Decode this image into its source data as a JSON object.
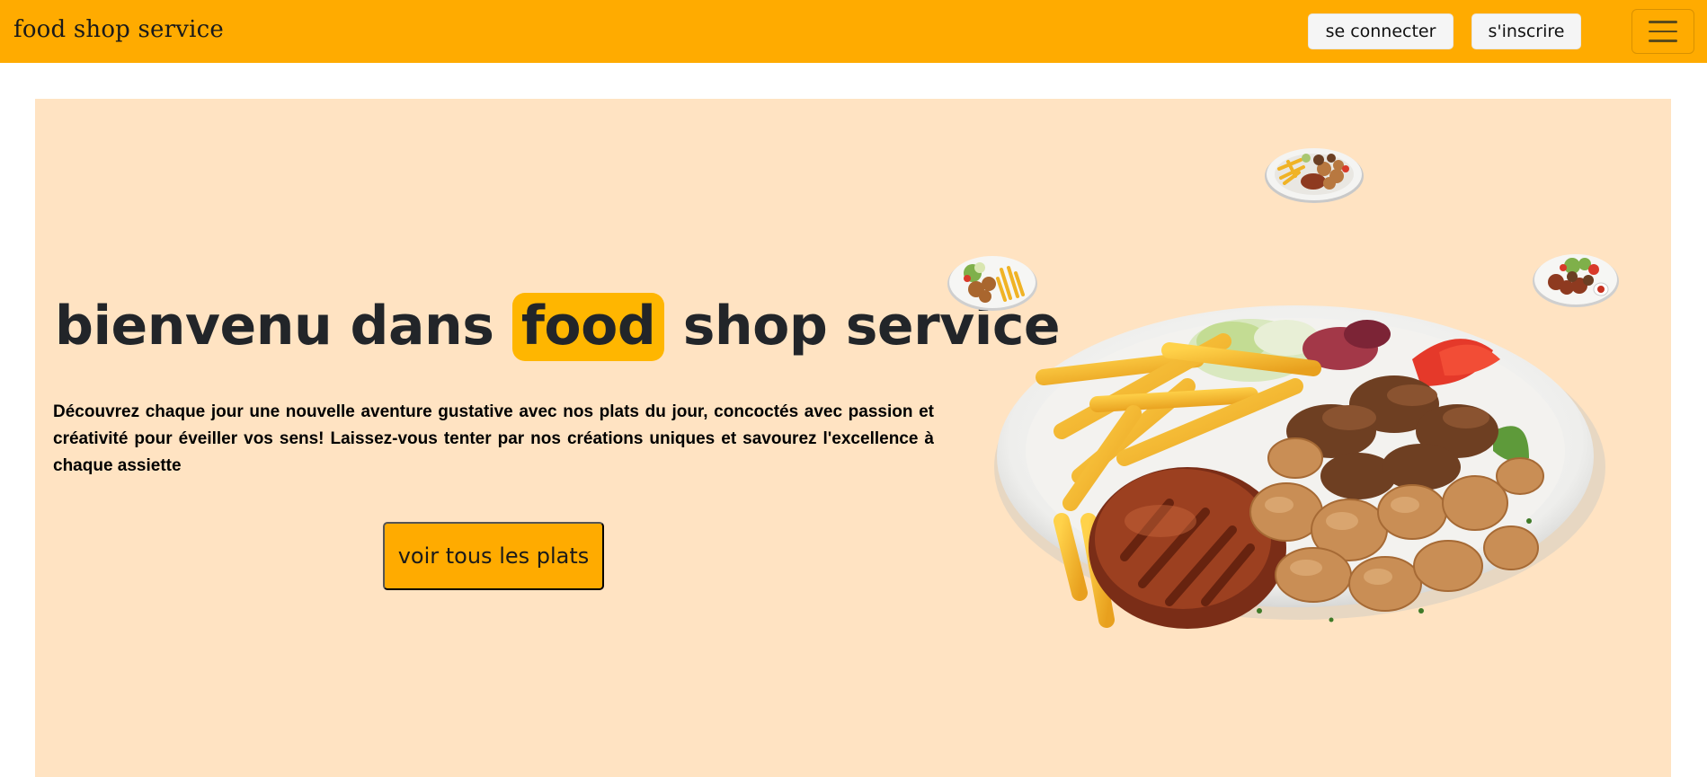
{
  "navbar": {
    "brand": "food shop service",
    "login_label": "se connecter",
    "signup_label": "s'inscrire",
    "menu_icon": "hamburger-icon",
    "background_color": "#ffab00"
  },
  "hero": {
    "title_before": "bienvenu dans ",
    "title_highlight": "food",
    "title_after": " shop service",
    "description": "Découvrez chaque jour une nouvelle aventure gustative avec nos plats du jour, concoctés avec passion et créativité pour éveiller vos sens! Laissez-vous tenter par nos créations uniques et savourez l'excellence à chaque assiette",
    "cta_label": "voir tous les plats",
    "background_color": "#ffe3c2",
    "highlight_color": "#ffb600"
  },
  "images": {
    "main": "food-plate-image",
    "small": [
      "food-plate-thumbnail",
      "food-plate-thumbnail",
      "food-plate-thumbnail"
    ]
  }
}
